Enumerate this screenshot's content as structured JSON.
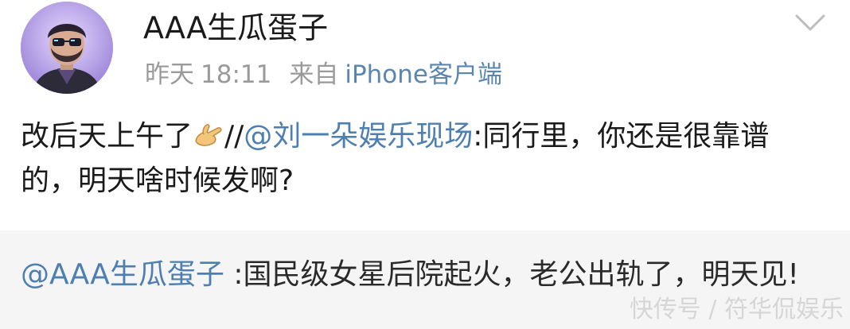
{
  "post": {
    "author_name": "AAA生瓜蛋子",
    "meta": {
      "date": "昨天",
      "time": "18:11",
      "source_prefix": "来自",
      "source_device": "iPhone客户端"
    },
    "content": {
      "text_before": "改后天上午了",
      "emoji": "hand-emoji",
      "separator": "//",
      "mention": "@刘一朵娱乐现场",
      "text_after": ":同行里，你还是很靠谱的，明天啥时候发啊?"
    }
  },
  "repost": {
    "mention": "@AAA生瓜蛋子",
    "text": " :国民级女星后院起火，老公出轨了，明天见!"
  },
  "watermark": "快传号 / 符华侃娱乐",
  "icons": {
    "menu": "chevron-down-icon",
    "avatar": "avatar"
  },
  "colors": {
    "mention": "#4d7fb0",
    "meta_text": "#9a9a9a",
    "repost_bg": "#f5f5f5"
  }
}
